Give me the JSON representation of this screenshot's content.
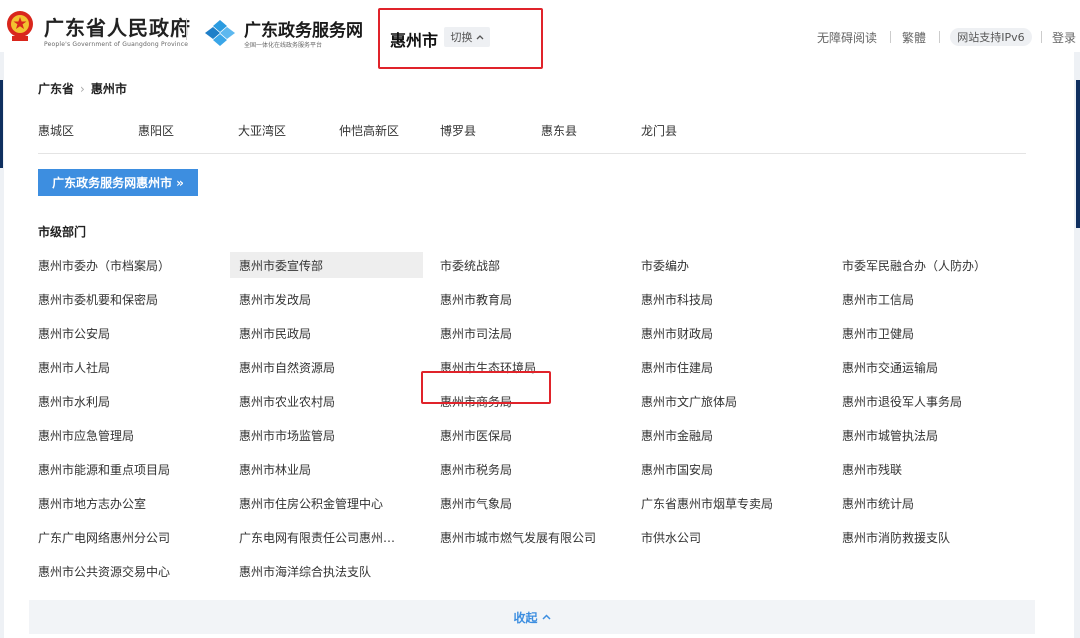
{
  "header": {
    "gov_title": "广东省人民政府",
    "gov_subtitle": "People's Government of Guangdong Province",
    "portal_title": "广东政务服务网",
    "portal_subtitle": "全国一体化在线政务服务平台",
    "current_city": "惠州市",
    "switch_label": "切换",
    "links": {
      "accessibility": "无障碍阅读",
      "traditional": "繁體",
      "ipv6": "网站支持IPv6",
      "login": "登录"
    }
  },
  "breadcrumb": [
    "广东省",
    "惠州市"
  ],
  "districts": [
    "惠城区",
    "惠阳区",
    "大亚湾区",
    "仲恺高新区",
    "博罗县",
    "惠东县",
    "龙门县"
  ],
  "portal_button": "广东政务服务网惠州市",
  "section_title": "市级部门",
  "departments": [
    [
      "惠州市委办（市档案局）",
      "惠州市委宣传部",
      "市委统战部",
      "市委编办",
      "市委军民融合办（人防办）"
    ],
    [
      "惠州市委机要和保密局",
      "惠州市发改局",
      "惠州市教育局",
      "惠州市科技局",
      "惠州市工信局"
    ],
    [
      "惠州市公安局",
      "惠州市民政局",
      "惠州市司法局",
      "惠州市财政局",
      "惠州市卫健局"
    ],
    [
      "惠州市人社局",
      "惠州市自然资源局",
      "惠州市生态环境局",
      "惠州市住建局",
      "惠州市交通运输局"
    ],
    [
      "惠州市水利局",
      "惠州市农业农村局",
      "惠州市商务局",
      "惠州市文广旅体局",
      "惠州市退役军人事务局"
    ],
    [
      "惠州市应急管理局",
      "惠州市市场监管局",
      "惠州市医保局",
      "惠州市金融局",
      "惠州市城管执法局"
    ],
    [
      "惠州市能源和重点项目局",
      "惠州市林业局",
      "惠州市税务局",
      "惠州市国安局",
      "惠州市残联"
    ],
    [
      "惠州市地方志办公室",
      "惠州市住房公积金管理中心",
      "惠州市气象局",
      "广东省惠州市烟草专卖局",
      "惠州市统计局"
    ],
    [
      "广东广电网络惠州分公司",
      "广东电网有限责任公司惠州…",
      "惠州市城市燃气发展有限公司",
      "市供水公司",
      "惠州市消防救援支队"
    ],
    [
      "惠州市公共资源交易中心",
      "惠州市海洋综合执法支队"
    ]
  ],
  "collapse_label": "收起",
  "colors": {
    "accent_blue": "#3d8ee0",
    "annotation_red": "#e0232a",
    "dark_navy": "#0f2f5f"
  }
}
